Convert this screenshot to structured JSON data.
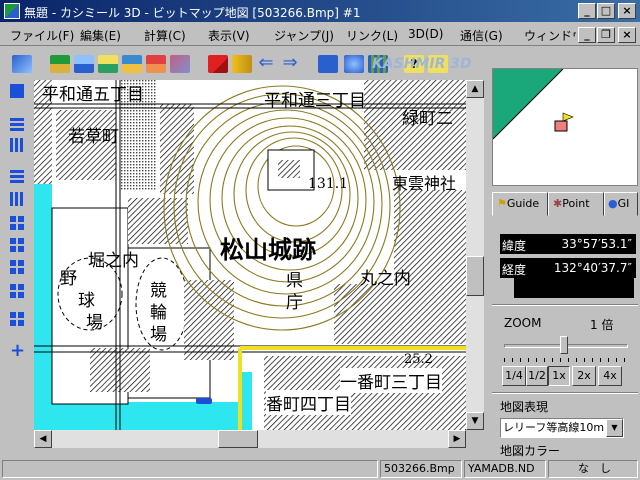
{
  "window": {
    "title": "無題 - カシミール 3D - ビットマップ地図 [503266.Bmp] #1"
  },
  "menu": [
    "ファイル(F)",
    "編集(E)",
    "計算(C)",
    "表示(V)",
    "ジャンプ(J)",
    "リンク(L)",
    "3D(D)",
    "通信(G)",
    "ウィンドウ(W)"
  ],
  "toolbar": {
    "watermark": "KASHMIR 3D"
  },
  "map": {
    "labels": {
      "top_left": "平和通五丁目",
      "top_mid": "平和通三丁目",
      "top_right": "緑町二",
      "wakakusa": "若草町",
      "elev": "131.1",
      "shinonome": "東雲神社",
      "castle": "松山城跡",
      "horinouchi": "堀之内",
      "ken": "県",
      "cho": "庁",
      "marunouchi": "丸之内",
      "yakyu": [
        "野",
        "球",
        "場"
      ],
      "keirin": [
        "競",
        "輪",
        "場"
      ],
      "ichiban3": "一番町三丁目",
      "ichiban4": "番町四丁目",
      "bm": "25.2"
    }
  },
  "panel": {
    "tabs": [
      "Guide",
      "Point",
      "GI"
    ],
    "lat_label": "緯度",
    "lat_value": "33°57′53.1″",
    "lon_label": "経度",
    "lon_value": "132°40′37.7″",
    "zoom_label": "ZOOM",
    "zoom_value": "1 倍",
    "zoom_buttons": [
      "1/4",
      "1/2",
      "1x",
      "2x",
      "4x"
    ],
    "zoom_selected": 2,
    "map_display_label": "地図表現",
    "map_display_value": "レリーフ等高線10m",
    "map_color_label": "地図カラー"
  },
  "status": {
    "file": "503266.Bmp",
    "db": "YAMADB.ND",
    "nashi": "な　し"
  },
  "colors": {
    "title_bar": "#0a246a",
    "water": "#2ee6f0",
    "contour": "#8b7a1f",
    "minimap_green": "#1aa77a",
    "accent_blue": "#1b4fd8"
  }
}
